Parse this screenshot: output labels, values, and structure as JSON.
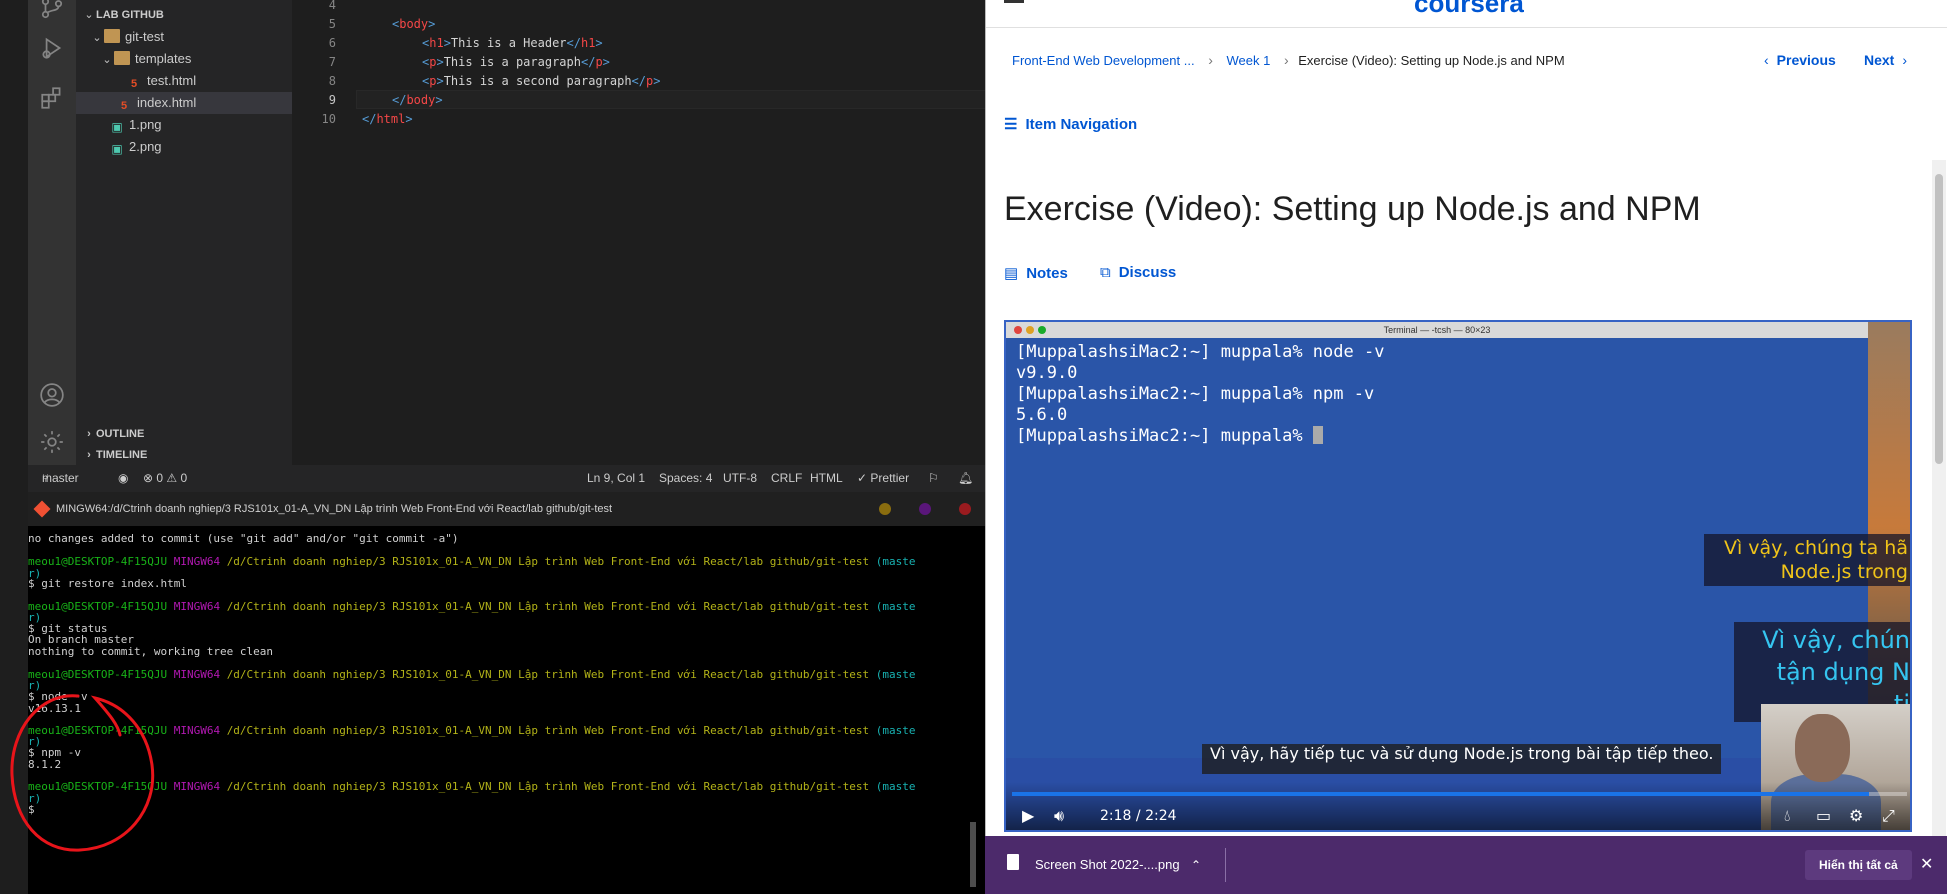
{
  "explorer": {
    "section_title": "LAB GITHUB",
    "items": [
      {
        "label": "git-test",
        "kind": "folder"
      },
      {
        "label": "templates",
        "kind": "folder"
      },
      {
        "label": "test.html",
        "kind": "html"
      },
      {
        "label": "index.html",
        "kind": "html"
      },
      {
        "label": "1.png",
        "kind": "png"
      },
      {
        "label": "2.png",
        "kind": "png"
      }
    ],
    "outline": "OUTLINE",
    "timeline": "TIMELINE"
  },
  "editor": {
    "lines": [
      {
        "num": "4",
        "code": ""
      },
      {
        "num": "5",
        "code": "<body>"
      },
      {
        "num": "6",
        "code": "<h1>This is a Header</h1>"
      },
      {
        "num": "7",
        "code": "<p>This is a paragraph</p>"
      },
      {
        "num": "8",
        "code": "<p>This is a second paragraph</p>"
      },
      {
        "num": "9",
        "code": "</body>"
      },
      {
        "num": "10",
        "code": "</html>"
      }
    ]
  },
  "statusbar": {
    "branch": "master",
    "problems": "⊗ 0 ⚠ 0",
    "position": "Ln 9, Col 1",
    "spaces": "Spaces: 4",
    "encoding": "UTF-8",
    "eol": "CRLF",
    "language": "HTML",
    "formatter": "✓ Prettier"
  },
  "terminal": {
    "title": "MINGW64:/d/Ctrinh doanh nghiep/3 RJS101x_01-A_VN_DN Lập trình Web Front-End với React/lab github/git-test",
    "prompt_user": "meou1@DESKTOP-4F15QJU",
    "prompt_sys": "MINGW64",
    "prompt_path": "/d/Ctrinh doanh nghiep/3 RJS101x_01-A_VN_DN Lập trình Web Front-End với React/lab github/git-test",
    "prompt_branch": "(maste",
    "prompt_branch_wrap": "r)",
    "line_hint": "no changes added to commit (use \"git add\" and/or \"git commit -a\")",
    "cmd1": "$ git restore index.html",
    "cmd2": "$ git status",
    "out2a": "On branch master",
    "out2b": "nothing to commit, working tree clean",
    "cmd3": "$ node -v",
    "out3": "v16.13.1",
    "cmd4": "$ npm -v",
    "out4": "8.1.2",
    "cmd5": "$"
  },
  "browser": {
    "logo": "coursera",
    "breadcrumb": {
      "course": "Front-End Web Development ...",
      "week": "Week 1",
      "current": "Exercise (Video): Setting up Node.js and NPM"
    },
    "prev_label": "Previous",
    "next_label": "Next",
    "item_nav_label": "Item Navigation",
    "page_title": "Exercise (Video): Setting up Node.js and NPM",
    "notes_label": "Notes",
    "discuss_label": "Discuss"
  },
  "video": {
    "term_window_title": "Terminal — -tcsh — 80×23",
    "term_lines": [
      "[MuppalashsiMac2:~] muppala% node -v",
      "v9.9.0",
      "[MuppalashsiMac2:~] muppala% npm -v",
      "5.6.0",
      "[MuppalashsiMac2:~] muppala% "
    ],
    "caption_yellow_1": "Vì vậy, chúng ta hã",
    "caption_yellow_2": "Node.js trong",
    "caption_blue_1": "Vì vậy, chún",
    "caption_blue_2": "tận dụng N",
    "caption_blue_3": "ti",
    "caption_main": "Vì vậy, hãy tiếp tục và sử dụng Node.js trong bài tập tiếp theo.",
    "time_current": "2:18",
    "time_sep": "/",
    "time_total": "2:24",
    "progress": 0.958
  },
  "downloads": {
    "file_label": "Screen Shot 2022-....png",
    "show_all_label": "Hiển thị tất cả"
  },
  "colors": {
    "accent": "#0056d2",
    "download_bar": "#4c2a6b",
    "annotation": "#e8141a"
  }
}
